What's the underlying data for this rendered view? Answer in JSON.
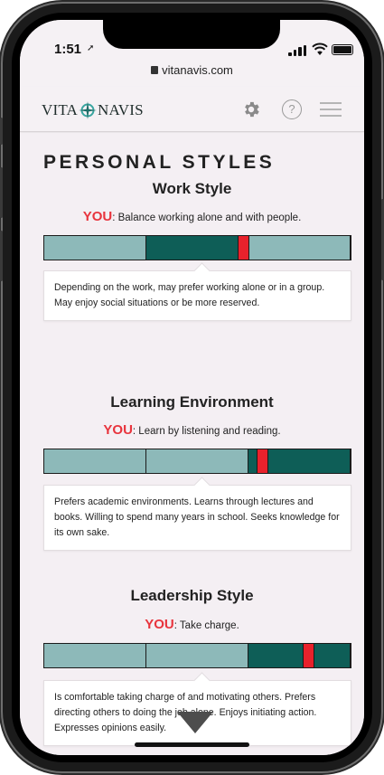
{
  "status": {
    "time": "1:51"
  },
  "browser": {
    "url": "vitanavis.com"
  },
  "header": {
    "logo_left": "VITA",
    "logo_right": "NAVIS"
  },
  "page": {
    "title": "PERSONAL STYLES"
  },
  "you_label": "YOU",
  "sections": [
    {
      "title": "Work Style",
      "you_text": ": Balance working alone and with people.",
      "bar_segments": [
        "light",
        "dark",
        "light"
      ],
      "marker_position": 0.65,
      "description": "Depending on the work, may prefer working alone or in a group. May enjoy social situations or be more reserved."
    },
    {
      "title": "Learning Environment",
      "you_text": ": Learn by listening and reading.",
      "bar_segments": [
        "light",
        "light",
        "dark"
      ],
      "marker_position": 0.71,
      "description": "Prefers academic environments. Learns through lectures and books. Willing to spend many years in school. Seeks knowledge for its own sake."
    },
    {
      "title": "Leadership Style",
      "you_text": ": Take charge.",
      "bar_segments": [
        "light",
        "light",
        "dark"
      ],
      "marker_position": 0.86,
      "description": "Is comfortable taking charge of and motivating others. Prefers directing others to doing the job alone. Enjoys initiating action. Expresses opinions easily."
    }
  ],
  "colors": {
    "accent_red": "#e8343d",
    "bar_dark": "#0e5e57",
    "bar_light": "#8db9b9"
  }
}
